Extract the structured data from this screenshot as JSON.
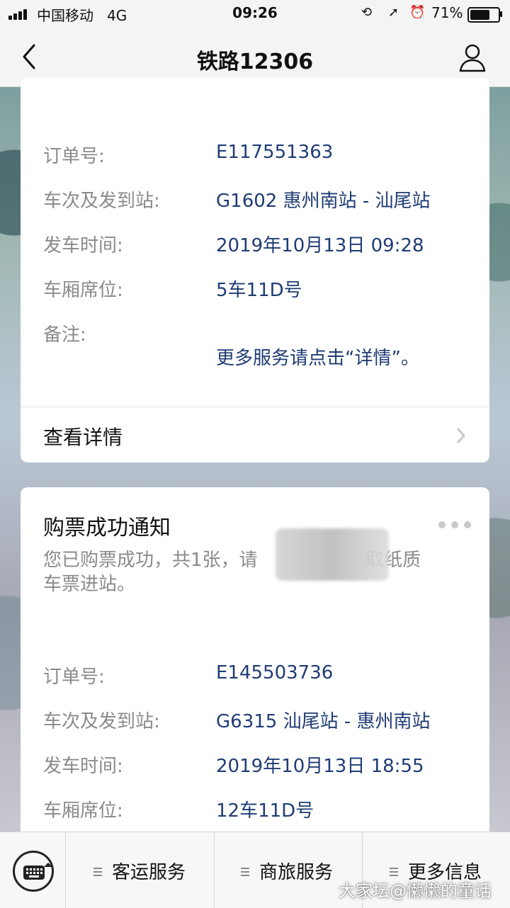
{
  "status_bar": {
    "carrier": "中国移动",
    "network": "4G",
    "time": "09:26",
    "battery_percent": "71%",
    "battery_level": 0.71,
    "icons": [
      "signal-icon",
      "rotation-lock-icon",
      "location-icon",
      "alarm-icon",
      "battery-icon"
    ]
  },
  "nav": {
    "title": "铁路12306",
    "back_icon": "chevron-left-icon",
    "user_icon": "person-icon"
  },
  "card1": {
    "rows": [
      {
        "label": "订单号:",
        "value": "E117551363"
      },
      {
        "label": "车次及发到站:",
        "value": "G1602  惠州南站 - 汕尾站"
      },
      {
        "label": "发车时间:",
        "value": "2019年10月13日 09:28"
      },
      {
        "label": "车厢席位:",
        "value": "5车11D号"
      },
      {
        "label": "备注:",
        "value": ""
      },
      {
        "label": "",
        "value": "更多服务请点击“详情”。"
      }
    ],
    "detail_label": "查看详情"
  },
  "card2": {
    "title": "购票成功通知",
    "desc_line1_a": "您已购票成功，共1张，请",
    "desc_line1_b": "取纸质",
    "desc_line2": "车票进站。",
    "rows": [
      {
        "label": "订单号:",
        "value": "E145503736"
      },
      {
        "label": "车次及发到站:",
        "value": "G6315  汕尾站 - 惠州南站"
      },
      {
        "label": "发车时间:",
        "value": "2019年10月13日 18:55"
      },
      {
        "label": "车厢席位:",
        "value": "12车11D号"
      }
    ]
  },
  "tabbar": {
    "tabs": [
      {
        "label": "客运服务"
      },
      {
        "label": "商旅服务"
      },
      {
        "label": "更多信息"
      }
    ],
    "keyboard_icon": "keyboard-icon"
  },
  "watermark": "大家坛@懒懒的童话",
  "colors": {
    "value_text": "#1f3c74",
    "label_text": "#8a8a8a",
    "bar_bg": "#f4f4f4"
  }
}
